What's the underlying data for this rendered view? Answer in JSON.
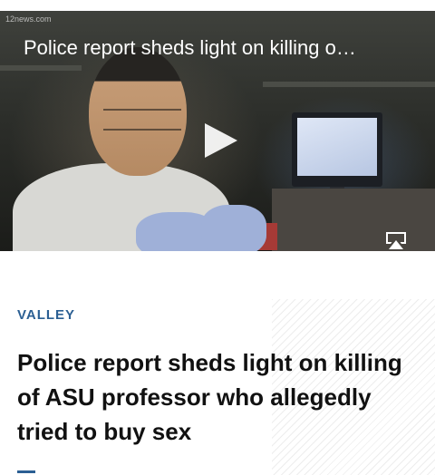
{
  "video": {
    "source_watermark": "12news.com",
    "title": "Police report sheds light on killing o…",
    "progress_percent": 0
  },
  "article": {
    "category": "VALLEY",
    "headline": "Police report sheds light on killing of ASU professor who allegedly tried to buy sex"
  },
  "colors": {
    "accent": "#2b5f93",
    "headline": "#111111"
  }
}
